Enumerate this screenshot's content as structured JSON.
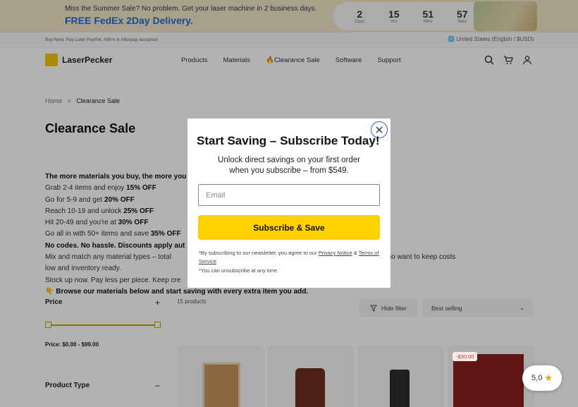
{
  "promo": {
    "line1": "Miss the Summer Sale? No problem. Get your laser machine in 2 business days.",
    "line2": "FREE FedEx 2Day Delivery.",
    "countdown": [
      {
        "value": "2",
        "label": "Days"
      },
      {
        "value": "15",
        "label": "Hrs"
      },
      {
        "value": "51",
        "label": "Mins"
      },
      {
        "value": "57",
        "label": "Secs"
      }
    ]
  },
  "infobar": {
    "left": "Buy Now, Pay Later PayPal, Affirm & Afterpay accepted",
    "region": "United States (English / $USD)"
  },
  "header": {
    "logo": "LaserPecker",
    "nav": [
      "Products",
      "Materials",
      "🔥Clearance Sale",
      "Software",
      "Support"
    ],
    "icons": [
      "search-icon",
      "cart-icon",
      "account-icon"
    ]
  },
  "breadcrumb": {
    "home": "Home",
    "sep": ">",
    "current": "Clearance Sale"
  },
  "page_title": "Clearance Sale",
  "copy": {
    "l1": "The more materials you buy, the more you",
    "l2a": "Grab 2-4 items and enjoy ",
    "l2b": "15% OFF",
    "l3a": "Go for 5-9 and get ",
    "l3b": "20% OFF",
    "l4a": "Reach 10-19 and unlock ",
    "l4b": "25% OFF",
    "l5a": "Hit 20-49 and you're at ",
    "l5b": "30% OFF",
    "l6a": "Go all in with 50+ items and save ",
    "l6b": "35% OFF",
    "l7": "No codes. No hassle. Discounts apply aut",
    "l8a": "Mix and match any material types – total",
    "l8b": "s, and bulk users who want to keep costs",
    "l9": "low and inventory ready.",
    "l10": "Stock up now. Pay less per piece. Keep cre",
    "l11": "👇 Browse our materials below and start saving with every extra item you add."
  },
  "filters": {
    "price_label": "Price",
    "price_range": "Price: $0.00 - $99.00",
    "product_type_label": "Product Type",
    "plus": "+",
    "minus": "–"
  },
  "listing": {
    "count": "15 products",
    "hide_filter": "Hide filter",
    "sort": "Best selling",
    "sale_tag": "-$30.00"
  },
  "modal": {
    "title": "Start Saving – Subscribe Today!",
    "subtitle1": "Unlock direct savings on your first order",
    "subtitle2": "when you subscribe – from $549.",
    "email_placeholder": "Email",
    "button": "Subscribe & Save",
    "legal1": "*By subscribing to our newsletter, you agree to our ",
    "privacy_link": "Privacy Notice",
    "amp": " & ",
    "terms_link": "Terms of Service",
    "legal2": "*You can unsubscribe at any time."
  },
  "rating": {
    "value": "5,0"
  },
  "colors": {
    "accent": "#ffd000",
    "promo_blue": "#1f6fd1",
    "close_ring": "#2f63c7"
  }
}
